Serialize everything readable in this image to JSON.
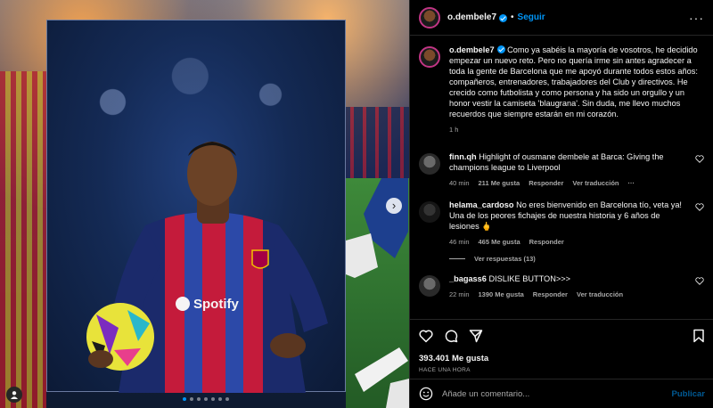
{
  "post": {
    "username": "o.dembele7",
    "separator": "•",
    "follow_label": "Seguir",
    "more_label": "···"
  },
  "caption": {
    "username": "o.dembele7",
    "text": "Como ya sabéis la mayoría de vosotros, he decidido empezar un nuevo reto. Pero no quería irme sin antes agradecer a toda la gente de Barcelona que me apoyó durante todos estos años: compañeros, entrenadores, trabajadores del Club y directivos. He crecido como futbolista y como persona y ha sido un orgullo y un honor vestir la camiseta 'blaugrana'. Sin duda, me llevo muchos recuerdos que siempre estarán en mi corazón.",
    "time": "1 h"
  },
  "comments": [
    {
      "username": "finn.qh",
      "text": "Highlight of ousmane dembele at Barca: Giving the champions league to Liverpool",
      "time": "40 min",
      "likes": "211 Me gusta",
      "reply": "Responder",
      "translate": "Ver traducción",
      "more": "···"
    },
    {
      "username": "helama_cardoso",
      "text": "No eres bienvenido en Barcelona tío, veta ya! Una de los peores fichajes de nuestra historia y 6 años de lesiones 🖕",
      "time": "46 min",
      "likes": "465 Me gusta",
      "reply": "Responder",
      "replies_label": "Ver respuestas (13)"
    },
    {
      "username": "_bagass6",
      "text": "DISLIKE BUTTON>>>",
      "time": "22 min",
      "likes": "1390 Me gusta",
      "reply": "Responder",
      "translate": "Ver traducción"
    }
  ],
  "stats": {
    "likes": "393.401 Me gusta",
    "time": "HACE UNA HORA"
  },
  "add_comment": {
    "placeholder": "Añade un comentario...",
    "publish": "Publicar"
  },
  "media": {
    "carousel_total": 7,
    "carousel_active": 0,
    "shirt_sponsor": "Spotify"
  },
  "colors": {
    "accent": "#0095f6",
    "background": "#000000",
    "muted_text": "#a8a8a8"
  }
}
